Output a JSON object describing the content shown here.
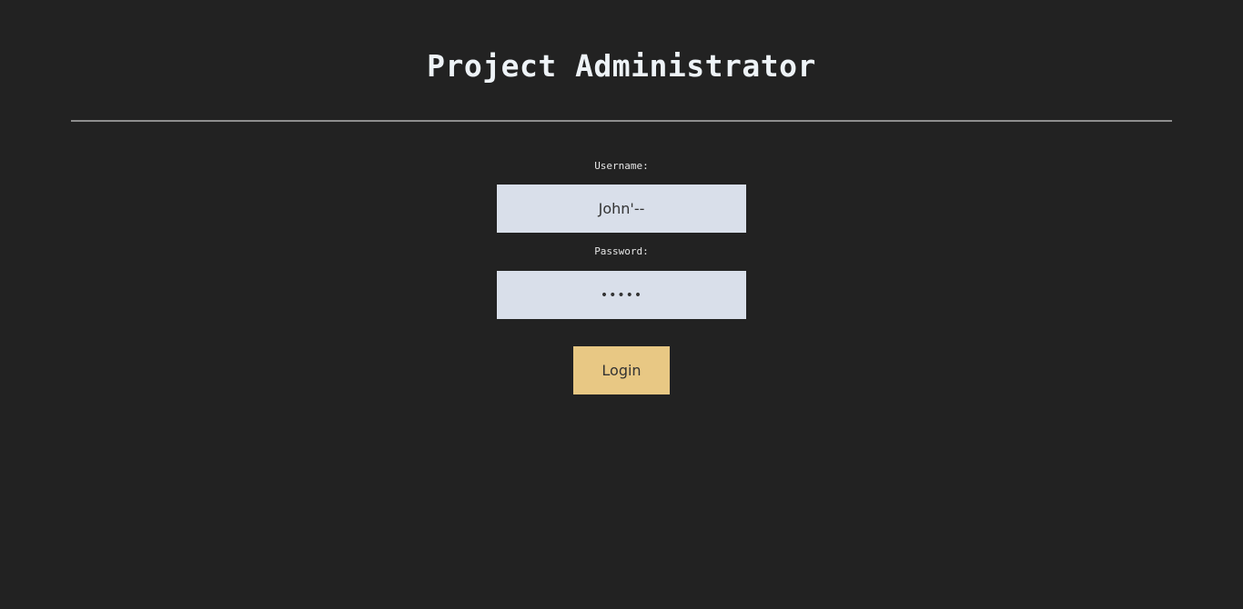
{
  "header": {
    "title": "Project Administrator"
  },
  "form": {
    "username_label": "Username:",
    "username_value": "John'--",
    "password_label": "Password:",
    "password_value": "•••••",
    "login_label": "Login"
  },
  "colors": {
    "background": "#222222",
    "title_text": "#eef3f7",
    "divider": "#8e8e8e",
    "input_background": "#d9dfea",
    "button_background": "#e8c884",
    "button_text": "#333333"
  }
}
